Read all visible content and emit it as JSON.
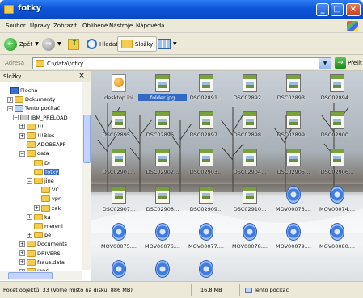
{
  "window": {
    "title": "fotky"
  },
  "menu": [
    "Soubor",
    "Úpravy",
    "Zobrazit",
    "Oblíbené",
    "Nástroje",
    "Nápověda"
  ],
  "toolbar": {
    "back": "Zpět",
    "search": "Hledat",
    "folders": "Složky"
  },
  "address": {
    "label": "Adresa",
    "value": "C:\\data\\fotky",
    "go": "Přejít"
  },
  "sidebar": {
    "title": "Složky",
    "tree": [
      {
        "label": "Plocha",
        "icon": "desktop",
        "toggle": ""
      },
      {
        "label": "Dokumenty",
        "icon": "folder",
        "toggle": "+"
      },
      {
        "label": "Tento počítač",
        "icon": "computer",
        "toggle": "−"
      },
      {
        "label": "IBM_PRELOAD",
        "icon": "drive",
        "toggle": "−"
      },
      {
        "label": "!!!",
        "icon": "folder",
        "toggle": "+"
      },
      {
        "label": "!!!Bios",
        "icon": "folder",
        "toggle": "+"
      },
      {
        "label": "ADOBEAPP",
        "icon": "folder",
        "toggle": ""
      },
      {
        "label": "data",
        "icon": "folder",
        "toggle": "−"
      },
      {
        "label": "Dr",
        "icon": "folder",
        "toggle": ""
      },
      {
        "label": "fotky",
        "icon": "folder",
        "toggle": "",
        "selected": true
      },
      {
        "label": "jine",
        "icon": "folder",
        "toggle": "−"
      },
      {
        "label": "VC",
        "icon": "folder",
        "toggle": ""
      },
      {
        "label": "vpr",
        "icon": "folder",
        "toggle": ""
      },
      {
        "label": "zak",
        "icon": "folder",
        "toggle": "+"
      },
      {
        "label": "ka",
        "icon": "folder",
        "toggle": "+"
      },
      {
        "label": "mereni",
        "icon": "folder",
        "toggle": ""
      },
      {
        "label": "pe",
        "icon": "folder",
        "toggle": "+"
      },
      {
        "label": "Documents",
        "icon": "folder",
        "toggle": "+"
      },
      {
        "label": "DRIVERS",
        "icon": "folder",
        "toggle": "+"
      },
      {
        "label": "fsaus.data",
        "icon": "folder",
        "toggle": "+"
      },
      {
        "label": "I386",
        "icon": "folder",
        "toggle": "+"
      }
    ]
  },
  "files": [
    {
      "name": "desktop.ini",
      "type": "html"
    },
    {
      "name": "folder.jpg",
      "type": "jpg",
      "selected": true
    },
    {
      "name": "DSC02891...",
      "type": "jpg"
    },
    {
      "name": "DSC02892...",
      "type": "jpg"
    },
    {
      "name": "DSC02893...",
      "type": "jpg"
    },
    {
      "name": "DSC02894...",
      "type": "jpg"
    },
    {
      "name": "DSC02895...",
      "type": "jpg"
    },
    {
      "name": "DSC02896...",
      "type": "jpg"
    },
    {
      "name": "DSC02897...",
      "type": "jpg"
    },
    {
      "name": "DSC02898...",
      "type": "jpg"
    },
    {
      "name": "DSC02899...",
      "type": "jpg"
    },
    {
      "name": "DSC02900...",
      "type": "jpg"
    },
    {
      "name": "DSC02901...",
      "type": "jpg"
    },
    {
      "name": "DSC02902...",
      "type": "jpg"
    },
    {
      "name": "DSC02903...",
      "type": "jpg"
    },
    {
      "name": "DSC02904...",
      "type": "jpg"
    },
    {
      "name": "DSC02905...",
      "type": "jpg"
    },
    {
      "name": "DSC02906...",
      "type": "jpg"
    },
    {
      "name": "DSC02907...",
      "type": "jpg"
    },
    {
      "name": "DSC02908...",
      "type": "jpg"
    },
    {
      "name": "DSC02909...",
      "type": "jpg"
    },
    {
      "name": "DSC02910...",
      "type": "jpg"
    },
    {
      "name": "MOV00073....",
      "type": "mov"
    },
    {
      "name": "MOV00074....",
      "type": "mov"
    },
    {
      "name": "MOV00075....",
      "type": "mov"
    },
    {
      "name": "MOV00076....",
      "type": "mov"
    },
    {
      "name": "MOV00077....",
      "type": "mov"
    },
    {
      "name": "MOV00078....",
      "type": "mov"
    },
    {
      "name": "MOV00079....",
      "type": "mov"
    },
    {
      "name": "MOV00080....",
      "type": "mov"
    },
    {
      "name": "",
      "type": "mov"
    },
    {
      "name": "",
      "type": "mov"
    },
    {
      "name": "",
      "type": "mov"
    }
  ],
  "status": {
    "objects": "Počet objektů: 33 (Volné místo na disku: 886 MB)",
    "size": "16,8 MB",
    "location": "Tento počítač"
  }
}
